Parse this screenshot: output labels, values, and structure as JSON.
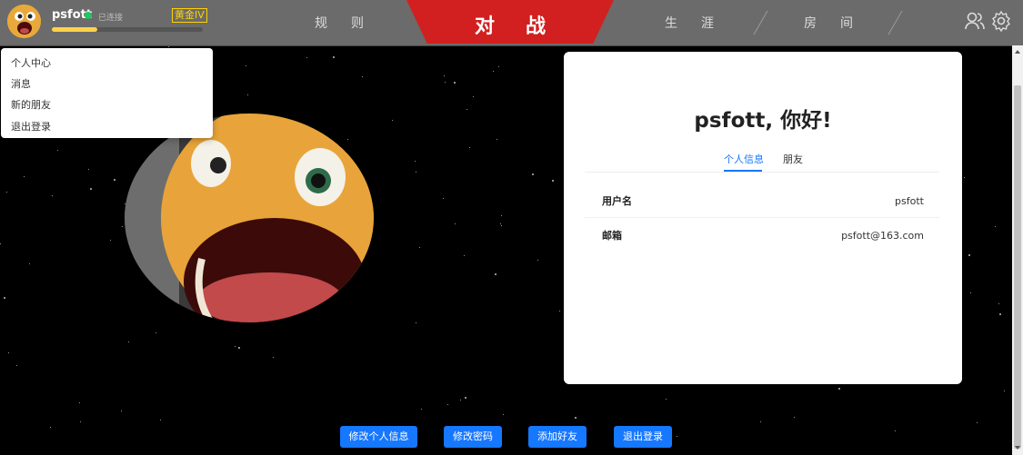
{
  "header": {
    "username": "psfott",
    "status": "已连接",
    "rank": "黄金IV",
    "xp_progress": 0.3,
    "nav": {
      "rules": "规则",
      "battle": "对战",
      "career": "生涯",
      "room": "房间"
    },
    "icons": [
      "friends-icon",
      "settings-icon"
    ]
  },
  "dropdown": {
    "items": [
      "个人中心",
      "消息",
      "新的朋友",
      "退出登录"
    ]
  },
  "profile": {
    "greeting": "psfott, 你好!",
    "tabs": [
      "个人信息",
      "朋友"
    ],
    "active_tab": 0,
    "rows": [
      {
        "label": "用户名",
        "value": "psfott"
      },
      {
        "label": "邮箱",
        "value": "psfott@163.com"
      }
    ]
  },
  "actions": {
    "edit_info": "修改个人信息",
    "change_password": "修改密码",
    "add_friend": "添加好友",
    "logout": "退出登录"
  },
  "colors": {
    "accent": "#1677ff",
    "battle": "#d21f1f",
    "rank": "#ffd200",
    "online": "#22c55e"
  }
}
